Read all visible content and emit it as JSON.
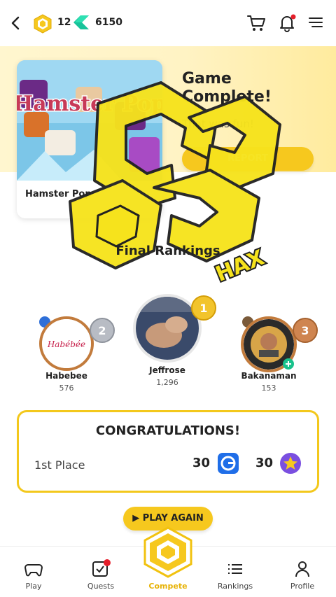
{
  "topbar": {
    "coins": "12",
    "gems": "6150",
    "icons": [
      "back-arrow-icon",
      "coin-icon",
      "gem-icon",
      "cart-icon",
      "bell-icon",
      "menu-icon"
    ]
  },
  "game": {
    "name": "Hamster Pop",
    "art_text": "Hamster Pop"
  },
  "hero": {
    "title": "Game Complete!",
    "subtitle": "That was fun!",
    "report_label": "REPORT"
  },
  "watermark": "HAX",
  "rankings": {
    "heading": "Final Rankings",
    "players": [
      {
        "rank": "2",
        "name": "Habebee",
        "score": "576",
        "avatar_text": "Habébée"
      },
      {
        "rank": "1",
        "name": "Jeffrose",
        "score": "1,296"
      },
      {
        "rank": "3",
        "name": "Bakanaman",
        "score": "153"
      }
    ]
  },
  "congrats": {
    "title": "CONGRATULATIONS!",
    "place": "1st Place",
    "reward_coins": "30",
    "reward_stars": "30"
  },
  "play_again": "PLAY AGAIN",
  "nav": [
    {
      "label": "Play",
      "icon": "gamepad-icon"
    },
    {
      "label": "Quests",
      "icon": "quests-icon"
    },
    {
      "label": "Compete",
      "icon": "compete-icon"
    },
    {
      "label": "Rankings",
      "icon": "rankings-icon"
    },
    {
      "label": "Profile",
      "icon": "profile-icon"
    }
  ],
  "colors": {
    "accent": "#f6c81e",
    "medal_gold": "#e7b308",
    "medal_silver": "#b8bcc4",
    "medal_bronze": "#c27b3c"
  }
}
